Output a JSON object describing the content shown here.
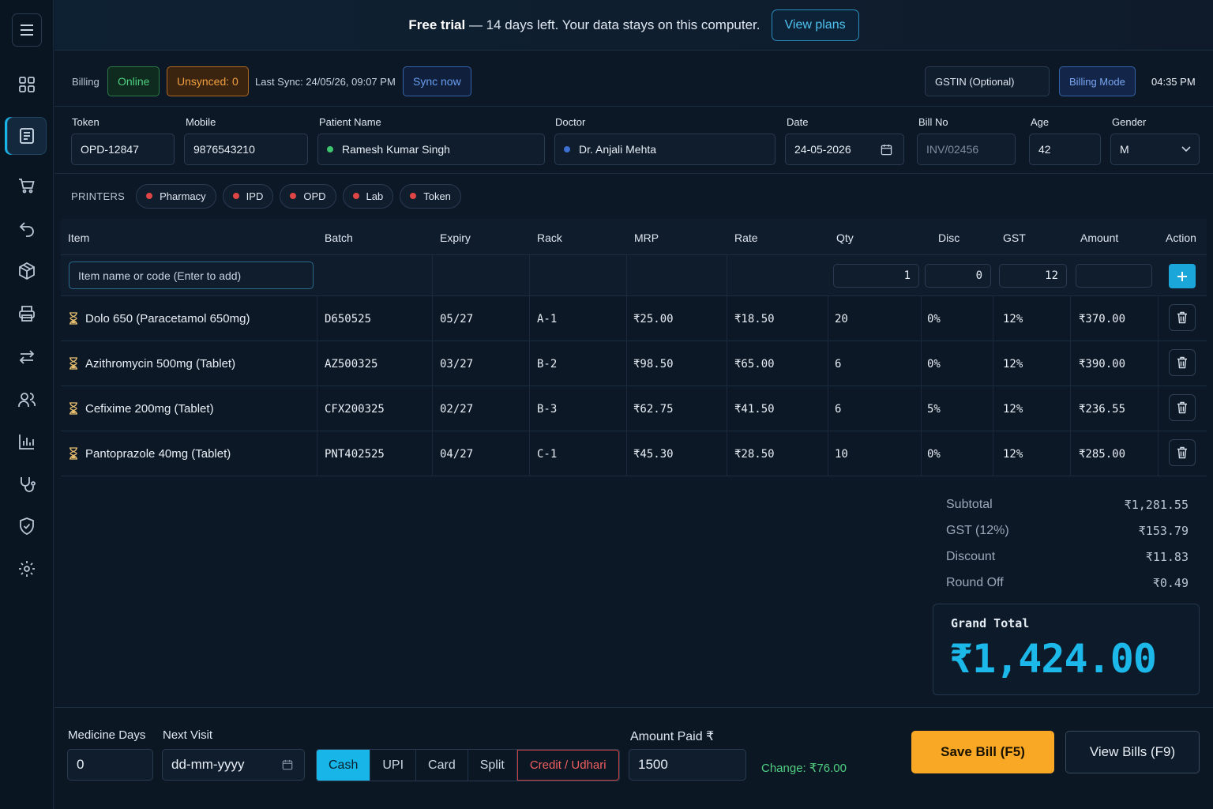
{
  "banner": {
    "strong": "Free trial",
    "text": "— 14 days left. Your data stays on this computer.",
    "button": "View plans"
  },
  "topbar": {
    "billing": "Billing",
    "online": "Online",
    "unsynced": "Unsynced: 0",
    "last_sync": "Last Sync: 24/05/26, 09:07 PM",
    "sync_now": "Sync now",
    "gstin": "GSTIN (Optional)",
    "billing_mode": "Billing Mode",
    "time": "04:35 PM"
  },
  "form": {
    "token_label": "Token",
    "token": "OPD-12847",
    "mobile_label": "Mobile",
    "mobile": "9876543210",
    "patient_label": "Patient Name",
    "patient": "Ramesh Kumar Singh",
    "doctor_label": "Doctor",
    "doctor": "Dr. Anjali Mehta",
    "date_label": "Date",
    "date": "24-05-2026",
    "bill_label": "Bill No",
    "bill_placeholder": "INV/02456",
    "age_label": "Age",
    "age": "42",
    "gender_label": "Gender",
    "gender": "M"
  },
  "printers": {
    "label": "PRINTERS",
    "items": [
      "Pharmacy",
      "IPD",
      "OPD",
      "Lab",
      "Token"
    ]
  },
  "table": {
    "headers": [
      "Item",
      "Batch",
      "Expiry",
      "Rack",
      "MRP",
      "Rate",
      "Qty",
      "Disc",
      "GST",
      "Amount",
      "Action"
    ],
    "add": {
      "placeholder": "Item name or code (Enter to add)",
      "qty": "1",
      "disc": "0",
      "gst": "12"
    },
    "rows": [
      [
        "Dolo 650 (Paracetamol 650mg)",
        "D650525",
        "05/27",
        "A-1",
        "₹25.00",
        "₹18.50",
        "20",
        "0%",
        "12%",
        "₹370.00"
      ],
      [
        "Azithromycin 500mg (Tablet)",
        "AZ500325",
        "03/27",
        "B-2",
        "₹98.50",
        "₹65.00",
        "6",
        "0%",
        "12%",
        "₹390.00"
      ],
      [
        "Cefixime 200mg (Tablet)",
        "CFX200325",
        "02/27",
        "B-3",
        "₹62.75",
        "₹41.50",
        "6",
        "5%",
        "12%",
        "₹236.55"
      ],
      [
        "Pantoprazole 40mg (Tablet)",
        "PNT402525",
        "04/27",
        "C-1",
        "₹45.30",
        "₹28.50",
        "10",
        "0%",
        "12%",
        "₹285.00"
      ]
    ]
  },
  "summary": {
    "rows": [
      [
        "Subtotal",
        "₹1,281.55"
      ],
      [
        "GST (12%)",
        "₹153.79"
      ],
      [
        "Discount",
        "₹11.83"
      ],
      [
        "Round Off",
        "₹0.49"
      ]
    ],
    "grand_label": "Grand Total",
    "grand_value": "₹1,424.00"
  },
  "footer": {
    "days_label": "Medicine Days",
    "days": "0",
    "next_label": "Next Visit",
    "next_placeholder": "dd-mm-yyyy",
    "pay_modes": [
      "Cash",
      "UPI",
      "Card",
      "Split",
      "Credit / Udhari"
    ],
    "paid_label": "Amount Paid ₹",
    "paid": "1500",
    "change": "Change: ₹76.00",
    "save": "Save Bill (F5)",
    "view": "View Bills (F9)"
  },
  "colors": {
    "accent": "#18b6e8",
    "save": "#f9a825",
    "online": "#3fc46f",
    "warn": "#f0a040",
    "credit": "#e05050"
  }
}
